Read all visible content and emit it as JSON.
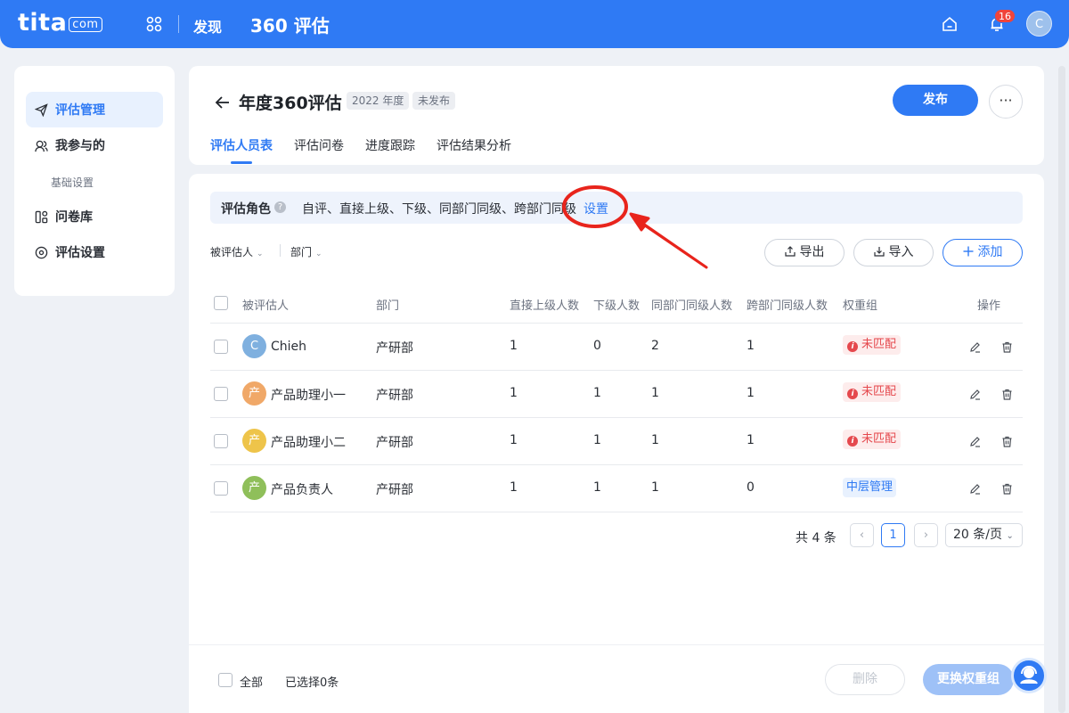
{
  "topbar": {
    "logo_main": "tita",
    "logo_suffix": "com",
    "nav_discover": "发现",
    "nav_title": "360 评估",
    "notification_count": "16",
    "user_initial": "C"
  },
  "sidebar": {
    "items": [
      {
        "label": "评估管理",
        "icon": "send-icon",
        "active": true
      },
      {
        "label": "我参与的",
        "icon": "people-icon",
        "active": false
      },
      {
        "label": "问卷库",
        "icon": "questionnaire-icon",
        "active": false
      },
      {
        "label": "评估设置",
        "icon": "settings-icon",
        "active": false
      }
    ],
    "section_label": "基础设置"
  },
  "header": {
    "title": "年度360评估",
    "year_tag": "2022 年度",
    "status_tag": "未发布",
    "publish_label": "发布",
    "more_label": "···",
    "tabs": [
      "评估人员表",
      "评估问卷",
      "进度跟踪",
      "评估结果分析"
    ],
    "active_tab": 0
  },
  "roles": {
    "label": "评估角色",
    "help": "?",
    "list": "自评、直接上级、下级、同部门同级、跨部门同级",
    "set_label": "设置"
  },
  "filters": {
    "evaluatee": "被评估人",
    "department": "部门"
  },
  "actions": {
    "export_label": "导出",
    "import_label": "导入",
    "add_label": "添加"
  },
  "table": {
    "headers": [
      "被评估人",
      "部门",
      "直接上级人数",
      "下级人数",
      "同部门同级人数",
      "跨部门同级人数",
      "权重组",
      "操作"
    ],
    "rows": [
      {
        "initial": "C",
        "avatar_color": "#7fb0df",
        "name": "Chieh",
        "dept": "产研部",
        "superiors": "1",
        "subordinates": "0",
        "same_dept": "2",
        "cross_dept": "1",
        "group": "未匹配",
        "group_type": "unmatched"
      },
      {
        "initial": "产",
        "avatar_color": "#f0a868",
        "name": "产品助理小一",
        "dept": "产研部",
        "superiors": "1",
        "subordinates": "1",
        "same_dept": "1",
        "cross_dept": "1",
        "group": "未匹配",
        "group_type": "unmatched"
      },
      {
        "initial": "产",
        "avatar_color": "#eec44a",
        "name": "产品助理小二",
        "dept": "产研部",
        "superiors": "1",
        "subordinates": "1",
        "same_dept": "1",
        "cross_dept": "1",
        "group": "未匹配",
        "group_type": "unmatched"
      },
      {
        "initial": "产",
        "avatar_color": "#8fbf5a",
        "name": "产品负责人",
        "dept": "产研部",
        "superiors": "1",
        "subordinates": "1",
        "same_dept": "1",
        "cross_dept": "0",
        "group": "中层管理",
        "group_type": "matched"
      }
    ]
  },
  "pagination": {
    "total": "共 4 条",
    "current_page": "1",
    "page_size": "20 条/页"
  },
  "footer": {
    "select_all": "全部",
    "selected": "已选择0条",
    "delete_label": "删除",
    "swap_group_label": "更换权重组"
  },
  "colors": {
    "primary": "#2f7af4",
    "danger": "#e5484d",
    "annotation": "#e8241c"
  }
}
